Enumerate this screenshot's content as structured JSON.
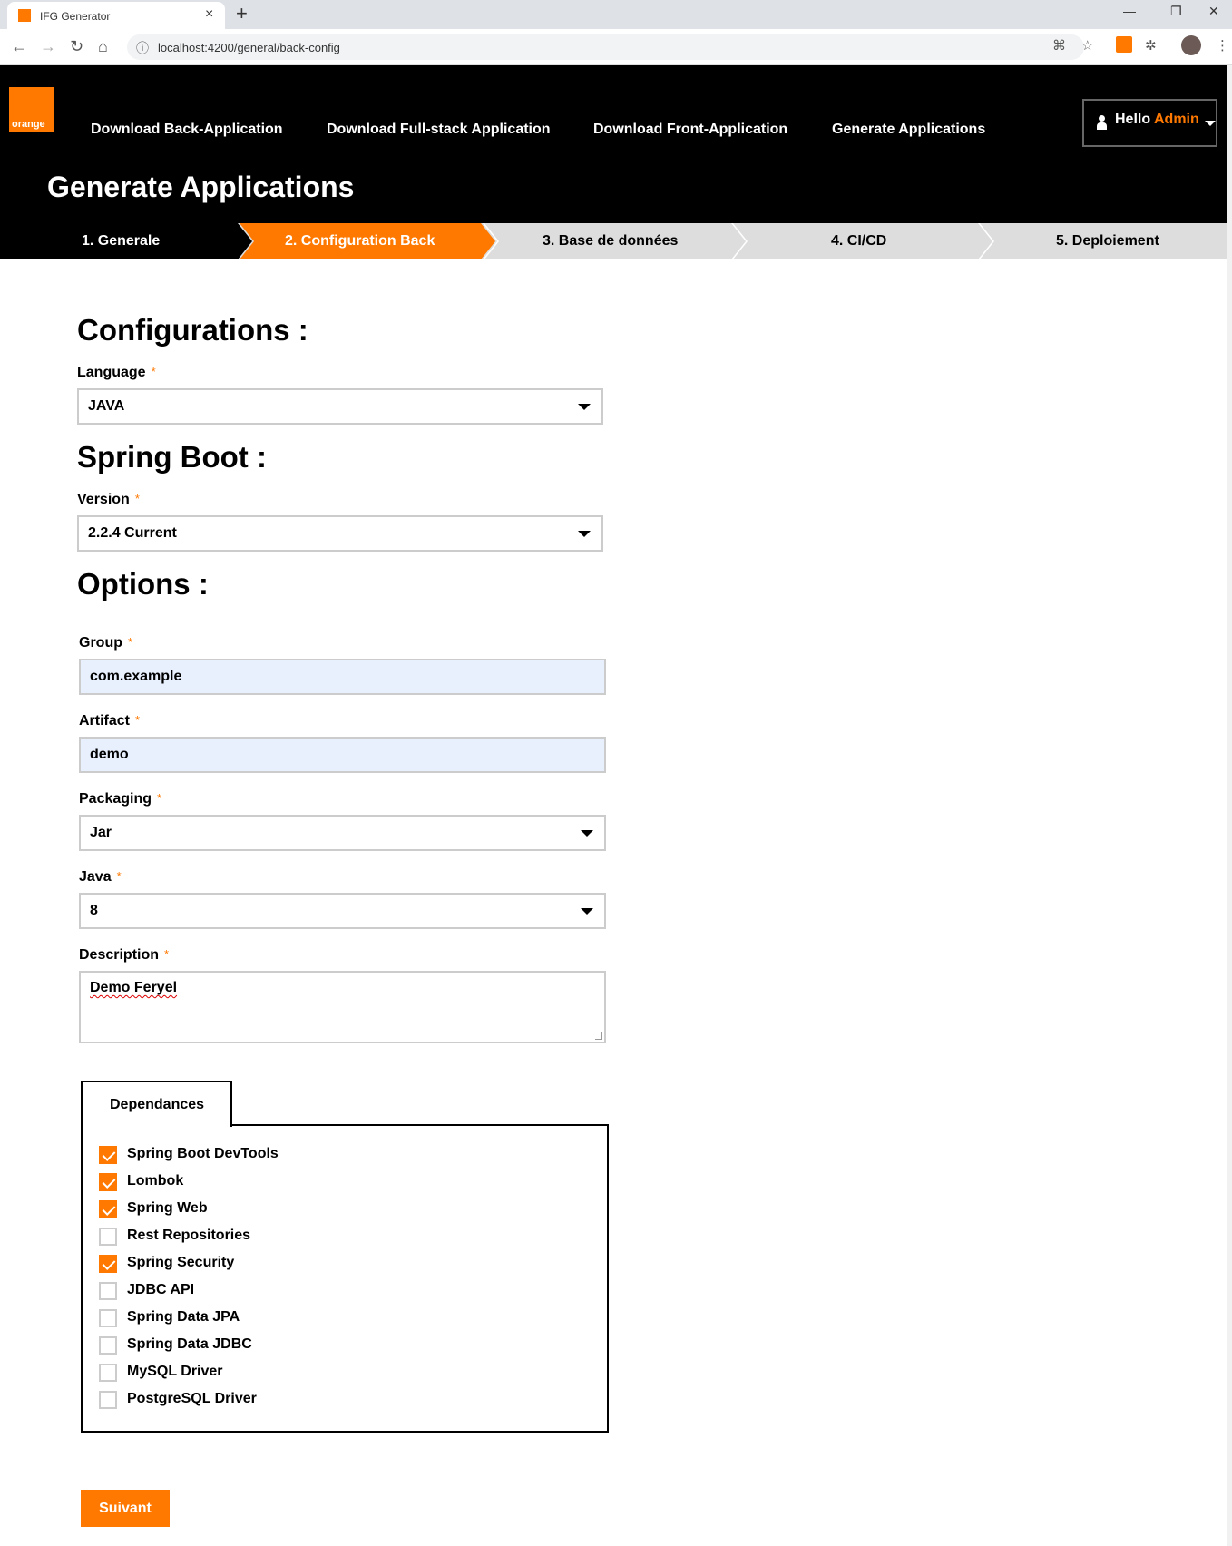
{
  "browser": {
    "tab_title": "IFG Generator",
    "tab_close": "×",
    "new_tab": "+",
    "url": "localhost:4200/general/back-config",
    "win_min": "—",
    "win_restore": "❐",
    "win_close": "✕"
  },
  "brand": {
    "logo_text": "orange",
    "accent": "#ff7900"
  },
  "header": {
    "nav": [
      "Download Back-Application",
      "Download Full-stack Application",
      "Download Front-Application",
      "Generate Applications"
    ],
    "hello": "Hello",
    "user": "Admin",
    "title": "Generate Applications"
  },
  "steps": [
    {
      "label": "1. Generale",
      "state": "done"
    },
    {
      "label": "2. Configuration Back",
      "state": "active"
    },
    {
      "label": "3. Base de données",
      "state": "todo"
    },
    {
      "label": "4. CI/CD",
      "state": "todo"
    },
    {
      "label": "5. Deploiement",
      "state": "todo"
    }
  ],
  "form": {
    "configurations_title": "Configurations :",
    "language_label": "Language",
    "language_value": "JAVA",
    "spring_title": "Spring Boot :",
    "version_label": "Version",
    "version_value": "2.2.4 Current",
    "options_title": "Options :",
    "group_label": "Group",
    "group_value": "com.example",
    "artifact_label": "Artifact",
    "artifact_value": "demo",
    "packaging_label": "Packaging",
    "packaging_value": "Jar",
    "java_label": "Java",
    "java_value": "8",
    "description_label": "Description",
    "description_value": "Demo Feryel",
    "required_mark": "*"
  },
  "dependencies": {
    "tab_label": "Dependances",
    "items": [
      {
        "label": "Spring Boot DevTools",
        "checked": true
      },
      {
        "label": "Lombok",
        "checked": true
      },
      {
        "label": "Spring Web",
        "checked": true
      },
      {
        "label": "Rest Repositories",
        "checked": false
      },
      {
        "label": "Spring Security",
        "checked": true
      },
      {
        "label": "JDBC API",
        "checked": false
      },
      {
        "label": "Spring Data JPA",
        "checked": false
      },
      {
        "label": "Spring Data JDBC",
        "checked": false
      },
      {
        "label": "MySQL Driver",
        "checked": false
      },
      {
        "label": "PostgreSQL Driver",
        "checked": false
      }
    ]
  },
  "actions": {
    "next_label": "Suivant"
  }
}
